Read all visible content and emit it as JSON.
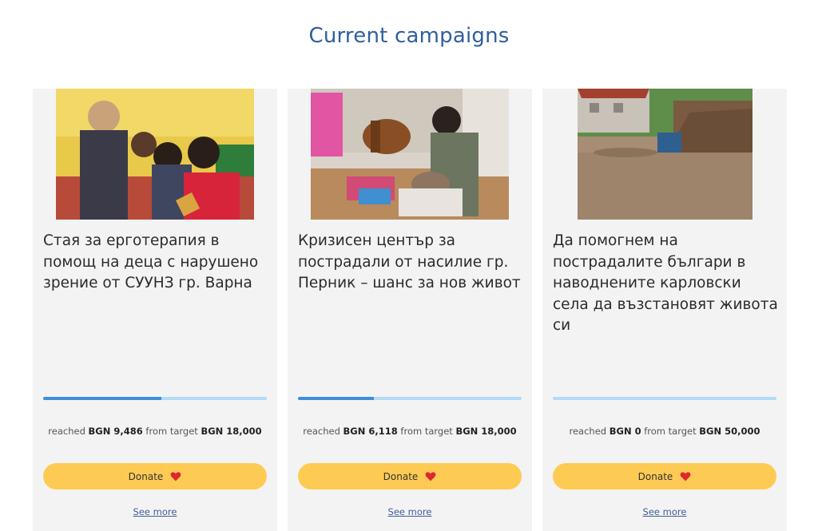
{
  "section": {
    "title": "Current campaigns"
  },
  "colors": {
    "title": "#2f5f9e",
    "progress_track": "#b3dbf7",
    "progress_fill": "#3d8fdc",
    "donate_bg": "#fdcb54",
    "heart": "#e0262f",
    "link": "#3f5f9b"
  },
  "cards": [
    {
      "image_icon": "classroom-photo",
      "title": "Стая за ерготерапия в помощ на деца с нарушено зрение от СУУНЗ гр. Варна",
      "reached_prefix": "reached",
      "reached_amount": "BGN 9,486",
      "target_prefix": "from target",
      "target_amount": "BGN 18,000",
      "progress_fraction": 0.527,
      "donate_label": "Donate",
      "see_more_label": "See more"
    },
    {
      "image_icon": "playroom-photo",
      "title": "Кризисен център за пострадали от насилие гр. Перник – шанс за нов живот",
      "reached_prefix": "reached",
      "reached_amount": "BGN 6,118",
      "target_prefix": "from target",
      "target_amount": "BGN 18,000",
      "progress_fraction": 0.34,
      "donate_label": "Donate",
      "see_more_label": "See more"
    },
    {
      "image_icon": "flood-photo",
      "title": "Да помогнем на пострадалите българи в наводнените карловски села да възстановят живота си",
      "reached_prefix": "reached",
      "reached_amount": "BGN 0",
      "target_prefix": "from target",
      "target_amount": "BGN 50,000",
      "progress_fraction": 0,
      "donate_label": "Donate",
      "see_more_label": "See more"
    }
  ]
}
